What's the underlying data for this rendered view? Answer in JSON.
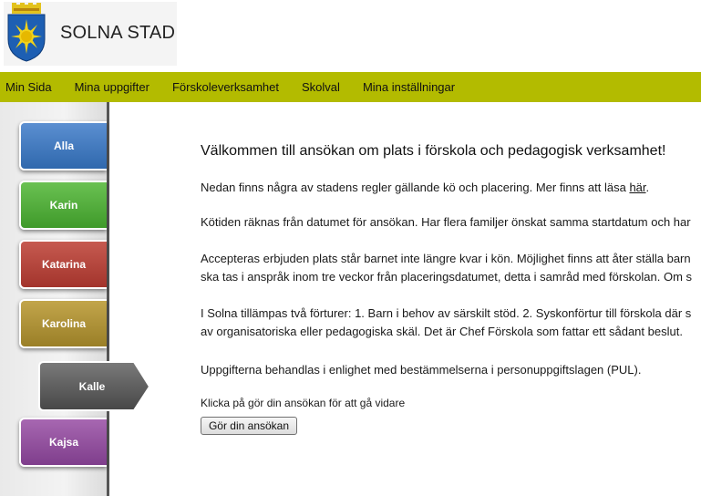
{
  "header": {
    "brand": "SOLNA STAD",
    "logo_icon": "solna-crest-icon"
  },
  "nav": {
    "items": [
      "Min Sida",
      "Mina uppgifter",
      "Förskoleverksamhet",
      "Skolval",
      "Mina inställningar"
    ],
    "color": "#b3bb00"
  },
  "sidebar": {
    "tabs": [
      {
        "label": "Alla",
        "color": "#3b76bf"
      },
      {
        "label": "Karin",
        "color": "#52ab3b"
      },
      {
        "label": "Katarina",
        "color": "#b4463d"
      },
      {
        "label": "Karolina",
        "color": "#ad9236"
      },
      {
        "label": "Kalle",
        "color": "#5a5a5a",
        "active": true
      },
      {
        "label": "Kajsa",
        "color": "#944f9f"
      }
    ]
  },
  "main": {
    "welcome": "Välkommen till ansökan om plats i förskola och pedagogisk verksamhet!",
    "p1_before": "Nedan finns några av stadens regler gällande kö och placering. Mer finns att läsa ",
    "p1_link": "här",
    "p1_after": ".",
    "p2": "Kötiden räknas från datumet för ansökan. Har flera familjer önskat samma startdatum och har",
    "p3_line1": "Accepteras erbjuden plats står barnet inte längre kvar i kön. Möjlighet finns att åter ställa barn",
    "p3_line2": "ska tas i anspråk inom tre veckor från placeringsdatumet, detta i samråd med förskolan. Om s",
    "p4_line1": "I Solna tillämpas två förturer: 1. Barn i behov av särskilt stöd. 2. Syskonförtur till förskola där s",
    "p4_line2": "av organisatoriska eller pedagogiska skäl. Det är Chef Förskola som fattar ett sådant beslut.",
    "p5": "Uppgifterna behandlas i enlighet med bestämmelserna i personuppgiftslagen (PUL).",
    "p6": "Klicka på gör din ansökan för att gå vidare",
    "apply_button": "Gör din ansökan"
  }
}
